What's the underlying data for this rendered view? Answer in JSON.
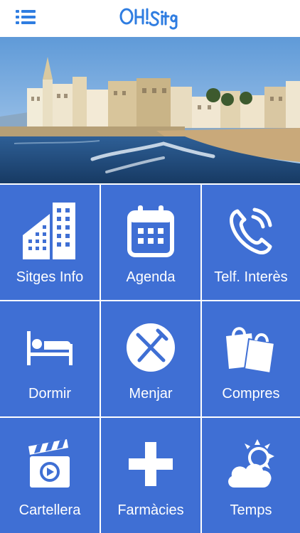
{
  "header": {
    "menu_icon": "hamburger-list-icon",
    "logo_text": "OH! Sitges"
  },
  "colors": {
    "tile_bg": "#3f6fd4",
    "accent": "#2f7de1",
    "header_bg": "#ffffff"
  },
  "banner": {
    "image": "Sitges seafront with church and beach"
  },
  "grid": {
    "items": [
      {
        "label": "Sitges Info",
        "icon": "building-icon"
      },
      {
        "label": "Agenda",
        "icon": "calendar-icon"
      },
      {
        "label": "Telf. Interès",
        "icon": "phone-icon"
      },
      {
        "label": "Dormir",
        "icon": "bed-icon"
      },
      {
        "label": "Menjar",
        "icon": "fork-knife-icon"
      },
      {
        "label": "Compres",
        "icon": "shopping-bags-icon"
      },
      {
        "label": "Cartellera",
        "icon": "clapperboard-icon"
      },
      {
        "label": "Farmàcies",
        "icon": "pharmacy-cross-icon"
      },
      {
        "label": "Temps",
        "icon": "weather-sun-cloud-icon"
      }
    ]
  }
}
